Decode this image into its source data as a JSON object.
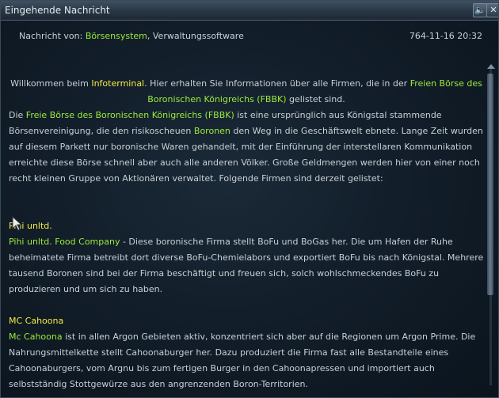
{
  "window": {
    "title": "Eingehende Nachricht",
    "buttons": {
      "sound": "🔈",
      "close": "✕"
    }
  },
  "header": {
    "from_label": "Nachricht von:",
    "sender_name": "Börsensystem",
    "sender_org": "Verwaltungssoftware",
    "datetime": "764-11-16  20:32"
  },
  "message": {
    "intro": {
      "text1": "Willkommen beim ",
      "highlight1": "Infoterminal",
      "text2": ". Hier erhalten Sie Informationen über alle Firmen, die in der ",
      "highlight2": "Freien Börse des Boronischen Königreichs (FBBK)",
      "text3": " gelistet sind."
    },
    "para2": {
      "text1": "Die ",
      "highlight1": "Freie Börse des Boronischen Königreichs (FBBK)",
      "text2": " ist eine ursprünglich aus Königstal stammende Börsenvereinigung, die den risikoscheuen ",
      "highlight2": "Boronen",
      "text3": " den Weg in die Geschäftswelt ebnete. Lange Zeit wurden auf diesem Parkett nur boronische Waren gehandelt, mit der Einführung der interstellaren Kommunikation erreichte diese Börse schnell aber auch alle anderen Völker. Große Geldmengen werden hier von einer noch recht kleinen Gruppe von Aktionären verwaltet. Folgende Firmen sind derzeit gelistet:"
    },
    "companies": [
      {
        "heading": "Pihi unltd.",
        "name": "Pihi unltd. Food Company",
        "description": " - Diese boronische Firma stellt BoFu und BoGas her. Die um Hafen der Ruhe beheimatete Firma betreibt dort diverse BoFu-Chemielabors und exportiert BoFu bis nach Königstal. Mehrere tausend Boronen sind bei der Firma beschäftigt und freuen sich, solch wohlschmeckendes BoFu zu produzieren und um sich zu haben."
      },
      {
        "heading": "MC Cahoona",
        "name": "Mc Cahoona",
        "description": " ist in allen Argon Gebieten aktiv, konzentriert sich aber auf die Regionen um Argon Prime. Die Nahrungsmittelkette stellt Cahoonaburger her. Dazu produziert die Firma fast alle Bestandteile eines Cahoonaburgers, vom Argnu bis zum fertigen Burger in den Cahoonapressen und importiert auch selbstständig Stottgewürze aus den angrenzenden Boron-Territorien."
      }
    ]
  },
  "colors": {
    "highlight_green": "#9bea3c",
    "highlight_yellow": "#f2ec40",
    "text": "#c8d0d6"
  }
}
